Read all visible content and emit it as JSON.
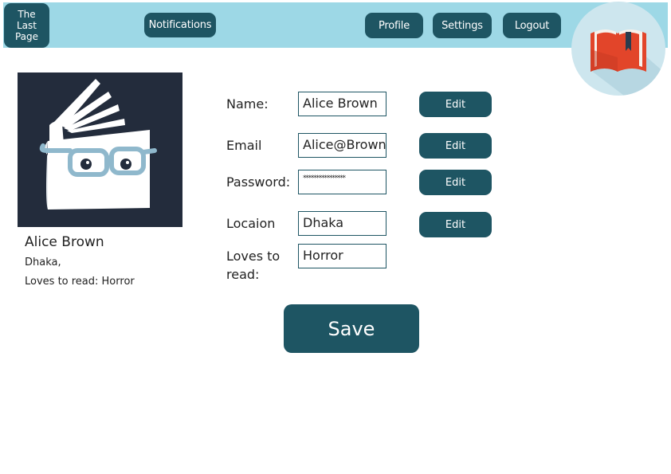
{
  "header": {
    "brand_line1": "The",
    "brand_line2": "Last",
    "brand_line3": "Page",
    "notifications_label": "Notifications",
    "profile_label": "Profile",
    "settings_label": "Settings",
    "logout_label": "Logout",
    "logo_icon": "open-book-icon"
  },
  "profile": {
    "avatar_icon": "book-with-glasses-icon",
    "name": "Alice Brown",
    "city": "Dhaka,",
    "loves": "Loves to read: Horror"
  },
  "form": {
    "name_label": "Name:",
    "name_value": "Alice Brown",
    "email_label": "Email",
    "email_value": "Alice@Brown",
    "password_label": "Password:",
    "password_value": "****************",
    "location_label": "Locaion",
    "location_value": "Dhaka",
    "loves_label_line1": "Loves to",
    "loves_label_line2": "read:",
    "loves_value": "Horror",
    "edit_label": "Edit",
    "save_label": "Save"
  },
  "colors": {
    "topbar": "#9dd8e6",
    "button": "#1e5563",
    "avatar_bg": "#232c3c",
    "logo_circle": "#cde6ee",
    "book_red": "#e2452a"
  }
}
